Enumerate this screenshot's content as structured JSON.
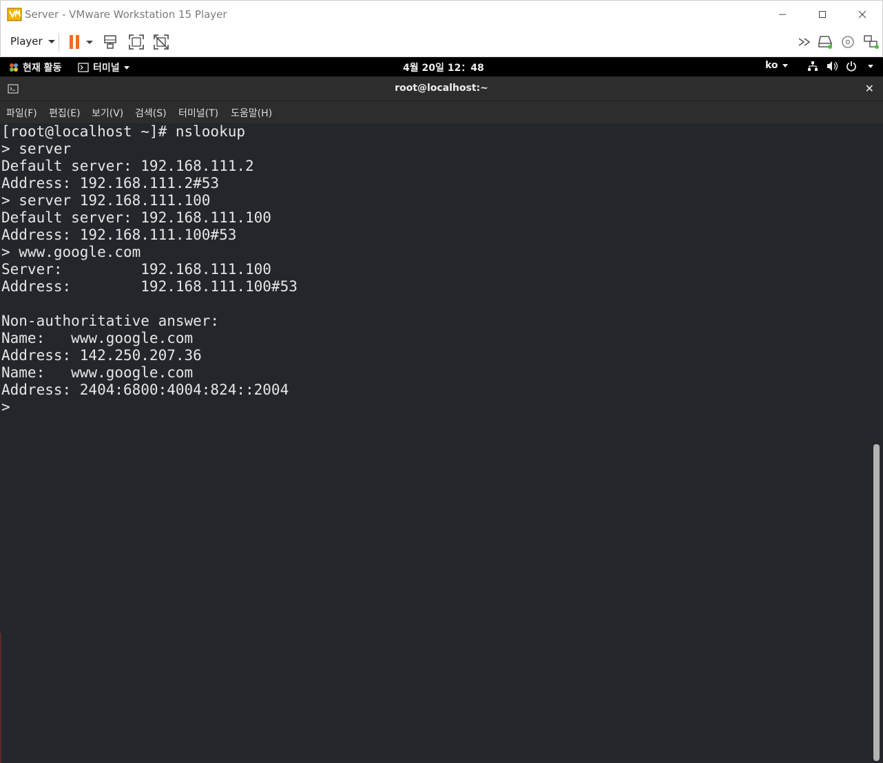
{
  "window": {
    "title": "Server - VMware Workstation 15 Player",
    "controls": [
      "minimize-icon",
      "maximize-icon",
      "close-icon"
    ]
  },
  "toolbar": {
    "player_label": "Player",
    "icons": [
      "pause-icon",
      "dropdown-caret-icon",
      "send-ctrl-alt-del-icon",
      "fullscreen-icon",
      "unity-icon"
    ],
    "right_icons": [
      "chevron-double-right-icon",
      "hard-disk-icon",
      "cd-dvd-icon",
      "network-adapter-icon"
    ],
    "pause_color": "#f26a21"
  },
  "gnome": {
    "activities": "현재 활동",
    "app_menu": "터미널",
    "clock": "4월 20일  12：48",
    "lang": "ko",
    "tray_icons": [
      "network-icon",
      "volume-icon",
      "power-icon",
      "chevron-down-icon"
    ]
  },
  "terminal": {
    "title": "root@localhost:~",
    "menu": [
      "파일(F)",
      "편집(E)",
      "보기(V)",
      "검색(S)",
      "터미널(T)",
      "도움말(H)"
    ],
    "lines": [
      "[root@localhost ~]# nslookup",
      "> server",
      "Default server: 192.168.111.2",
      "Address: 192.168.111.2#53",
      "> server 192.168.111.100",
      "Default server: 192.168.111.100",
      "Address: 192.168.111.100#53",
      "> www.google.com",
      "Server:         192.168.111.100",
      "Address:        192.168.111.100#53",
      "",
      "Non-authoritative answer:",
      "Name:   www.google.com",
      "Address: 142.250.207.36",
      "Name:   www.google.com",
      "Address: 2404:6800:4004:824::2004",
      ">"
    ],
    "background": "#23272b",
    "foreground": "#e6e6e6"
  }
}
